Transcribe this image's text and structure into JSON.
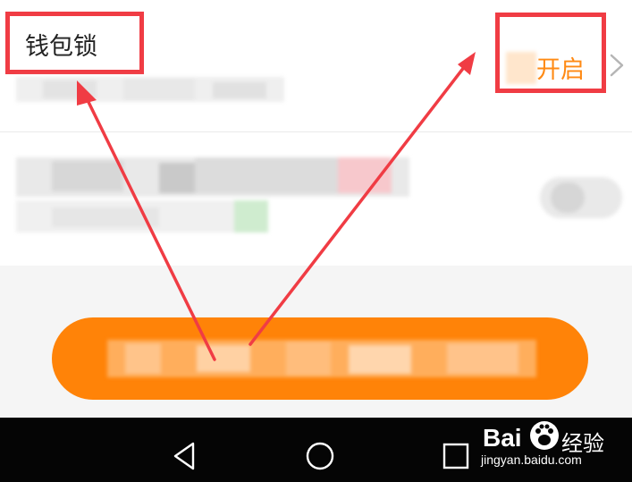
{
  "wallet_lock": {
    "title": "钱包锁",
    "status": "开启"
  },
  "watermark": {
    "brand_left": "Bai",
    "brand_right": "经验",
    "url": "jingyan.baidu.com"
  },
  "colors": {
    "annotation": "#f03c44",
    "accent_orange": "#ff8308",
    "status_text": "#ff8a14",
    "navbar": "#050505"
  },
  "icons": {
    "chevron": "chevron-right-icon",
    "nav_back": "nav-back-icon",
    "nav_home": "nav-home-icon",
    "nav_recent": "nav-recent-icon",
    "watermark_paw": "baidu-paw-icon"
  }
}
